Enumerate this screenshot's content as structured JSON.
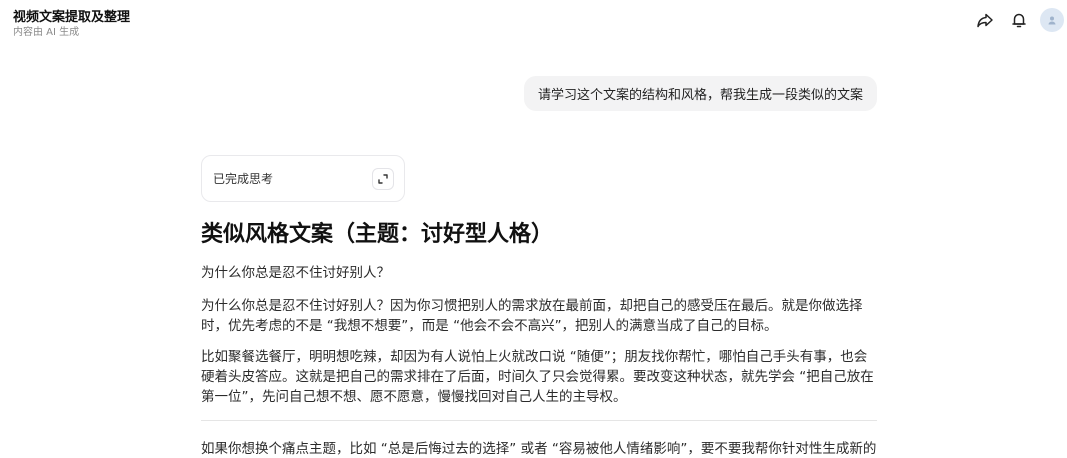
{
  "header": {
    "title": "视频文案提取及整理",
    "subtitle": "内容由 AI 生成",
    "icons": [
      "share-icon",
      "bell-icon",
      "avatar"
    ]
  },
  "chat": {
    "user_message": "请学习这个文案的结构和风格，帮我生成一段类似的文案",
    "thinking_label": "已完成思考",
    "answer": {
      "heading": "类似风格文案（主题：讨好型人格）",
      "p1": "为什么你总是忍不住讨好别人？",
      "p2": "为什么你总是忍不住讨好别人？因为你习惯把别人的需求放在最前面，却把自己的感受压在最后。就是你做选择时，优先考虑的不是 “我想不想要”，而是 “他会不会不高兴”，把别人的满意当成了自己的目标。",
      "p3": "比如聚餐选餐厅，明明想吃辣，却因为有人说怕上火就改口说 “随便”；朋友找你帮忙，哪怕自己手头有事，也会硬着头皮答应。这就是把自己的需求排在了后面，时间久了只会觉得累。要改变这种状态，就先学会 “把自己放在第一位”，先问自己想不想、愿不愿意，慢慢找回对自己人生的主导权。",
      "p4": "如果你想换个痛点主题，比如 “总是后悔过去的选择” 或者 “容易被他人情绪影响”，要不要我帮你针对性生成新的"
    }
  },
  "colors": {
    "user_bubble_bg": "#f3f3f4",
    "avatar_bg": "#dde7f3"
  }
}
